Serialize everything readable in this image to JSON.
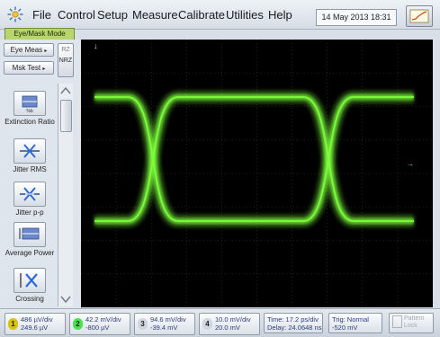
{
  "menubar": {
    "icon": "app-sunburst-icon",
    "items": [
      "File",
      "Control",
      "Setup",
      "Measure",
      "Calibrate",
      "Utilities",
      "Help"
    ],
    "date": "14 May 2013  18:31"
  },
  "mode_label": "Eye/Mask Mode",
  "leftpanel": {
    "eye_meas": "Eye Meas",
    "mask_test": "Msk Test",
    "rz": "RZ",
    "nrz": "NRZ",
    "tools": [
      {
        "label": "Extinction Ratio",
        "icon": "extinction-ratio-icon"
      },
      {
        "label": "Jitter RMS",
        "icon": "jitter-rms-icon"
      },
      {
        "label": "Jitter p-p",
        "icon": "jitter-pp-icon"
      },
      {
        "label": "Average Power",
        "icon": "average-power-icon"
      },
      {
        "label": "Crossing Percentage",
        "icon": "crossing-percentage-icon"
      }
    ]
  },
  "bottombar": {
    "channels": [
      {
        "num": "1",
        "line1": "486 µV/div",
        "line2": "249.6 µV",
        "color": "#c8b400"
      },
      {
        "num": "2",
        "line1": "42.2 mV/div",
        "line2": "-800 µV",
        "color": "#3fd13f"
      },
      {
        "num": "3",
        "line1": "94.6 mV/div",
        "line2": "-39.4 mV",
        "color": "#cfd6df"
      },
      {
        "num": "4",
        "line1": "10.0 mV/div",
        "line2": "20.0 mV",
        "color": "#cfd6df"
      }
    ],
    "time": {
      "line1": "Time: 17.2 ps/div",
      "line2": "Delay: 24.0648 ns"
    },
    "trig": {
      "line1": "Trig: Normal",
      "line2": "-520 mV"
    },
    "pattern_lock": "Pattern Lock"
  },
  "colors": {
    "trace": "#7cff3a",
    "grid": "#3a3a3a",
    "screen": "#000000"
  }
}
